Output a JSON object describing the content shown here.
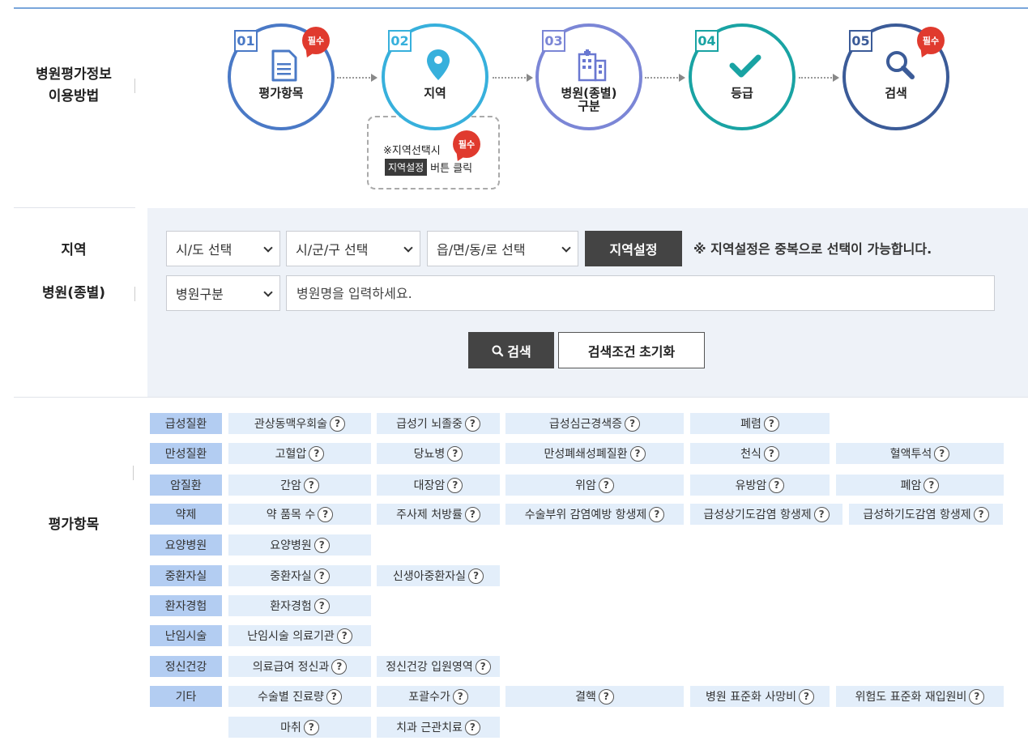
{
  "usage": {
    "label_line1": "병원평가정보",
    "label_line2": "이용방법",
    "required_badge": "필수",
    "steps": [
      {
        "num": "01",
        "label": "평가항목",
        "color": "#4a79c6",
        "required": true
      },
      {
        "num": "02",
        "label": "지역",
        "color": "#37b0dc",
        "required": false
      },
      {
        "num": "03",
        "label_line1": "병원(종별)",
        "label_line2": "구분",
        "color": "#7b86d6",
        "required": false
      },
      {
        "num": "04",
        "label": "등급",
        "color": "#19a3a3",
        "required": false
      },
      {
        "num": "05",
        "label": "검색",
        "color": "#3b5b98",
        "required": true
      }
    ],
    "region_note": {
      "line1": "※지역선택시",
      "button_text": "지역설정",
      "line2_suffix": "버튼 클릭"
    }
  },
  "search": {
    "label_region": "지역",
    "label_hospital": "병원(종별)",
    "sido": "시/도 선택",
    "sigungu": "시/군/구 선택",
    "eupmyeondong": "읍/면/동/로 선택",
    "region_set_button": "지역설정",
    "notice": "※ 지역설정은 중복으로 선택이 가능합니다.",
    "hospital_type": "병원구분",
    "name_placeholder": "병원명을 입력하세요.",
    "search_button": "검색",
    "reset_button": "검색조건 초기화"
  },
  "items": {
    "label": "평가항목",
    "help_glyph": "?",
    "rows": [
      {
        "category": "급성질환",
        "items": [
          "관상동맥우회술",
          "급성기 뇌졸중",
          "급성심근경색증",
          "폐렴"
        ]
      },
      {
        "category": "만성질환",
        "items": [
          "고혈압",
          "당뇨병",
          "만성폐쇄성폐질환",
          "천식",
          "혈액투석"
        ]
      },
      {
        "category": "암질환",
        "items": [
          "간암",
          "대장암",
          "위암",
          "유방암",
          "폐암"
        ]
      },
      {
        "category": "약제",
        "items": [
          "약 품목 수",
          "주사제 처방률",
          "수술부위 감염예방 항생제",
          "급성상기도감염 항생제",
          "급성하기도감염 항생제"
        ]
      },
      {
        "category": "요양병원",
        "items": [
          "요양병원"
        ]
      },
      {
        "category": "중환자실",
        "items": [
          "중환자실",
          "신생아중환자실"
        ]
      },
      {
        "category": "환자경험",
        "items": [
          "환자경험"
        ]
      },
      {
        "category": "난임시술",
        "items": [
          "난임시술 의료기관"
        ]
      },
      {
        "category": "정신건강",
        "items": [
          "의료급여 정신과",
          "정신건강 입원영역"
        ]
      },
      {
        "category": "기타",
        "items": [
          "수술별 진료량",
          "포괄수가",
          "결핵",
          "병원 표준화 사망비",
          "위험도 표준화 재입원비",
          "마취",
          "치과 근관치료"
        ]
      }
    ]
  }
}
